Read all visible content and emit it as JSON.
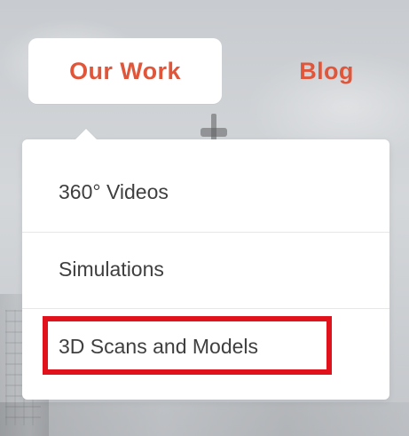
{
  "colors": {
    "accent": "#e0563a",
    "highlight": "#e1121b"
  },
  "nav": {
    "items": [
      {
        "label": "Our Work",
        "state": "active"
      },
      {
        "label": "Blog",
        "state": "normal"
      }
    ]
  },
  "dropdown": {
    "items": [
      {
        "label": "360° Videos"
      },
      {
        "label": "Simulations"
      },
      {
        "label": "3D Scans and Models"
      }
    ]
  }
}
